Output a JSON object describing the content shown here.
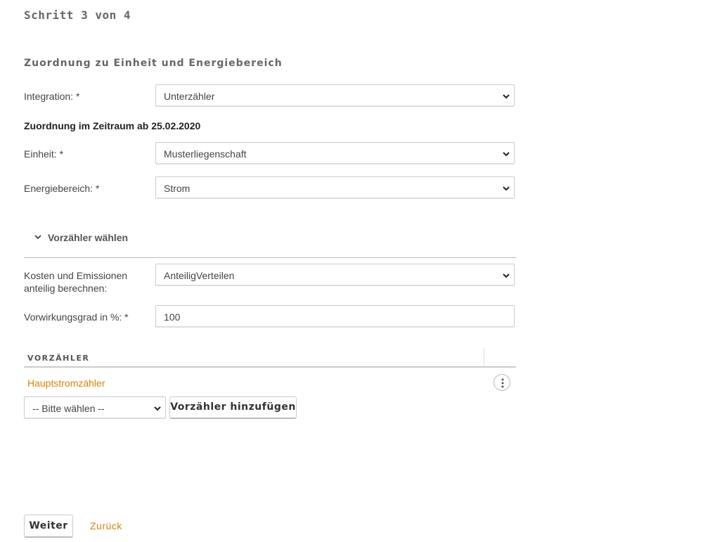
{
  "header": {
    "step": "Schritt 3 von 4"
  },
  "section": {
    "title": "Zuordnung zu Einheit und Energiebereich"
  },
  "integration": {
    "label": "Integration: *",
    "value": "Unterzähler"
  },
  "period": {
    "heading": "Zuordnung im Zeitraum ab 25.02.2020"
  },
  "unit": {
    "label": "Einheit: *",
    "value": "Musterliegenschaft"
  },
  "energy": {
    "label": "Energiebereich: *",
    "value": "Strom"
  },
  "premeter_toggle": {
    "label": "Vorzähler wählen",
    "icon": "chevron-down-icon"
  },
  "costs": {
    "label": "Kosten und Emissionen anteilig berechnen:",
    "value": "AnteiligVerteilen"
  },
  "efficiency": {
    "label": "Vorwirkungsgrad in %: *",
    "value": "100"
  },
  "premeter_table": {
    "column": "VORZÄHLER",
    "rows": [
      {
        "name": "Hauptstromzähler",
        "action_icon": "more-vertical-icon"
      }
    ]
  },
  "add_premeter": {
    "select_value": "-- Bitte wählen --",
    "button_label": "Vorzähler hinzufügen"
  },
  "footer": {
    "next_label": "Weiter",
    "back_label": "Zurück"
  },
  "colors": {
    "accent": "#d98300",
    "text": "#333333",
    "border": "#cccccc"
  }
}
